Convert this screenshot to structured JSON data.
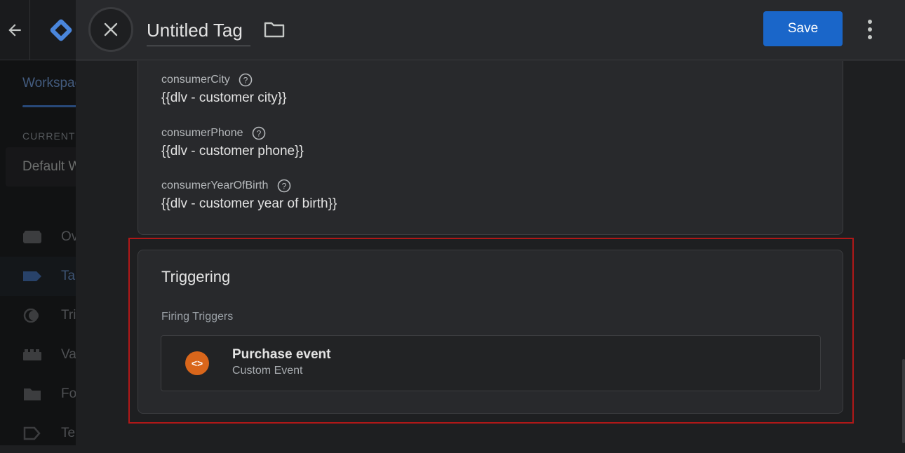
{
  "background": {
    "workspace_tab": "Workspace",
    "current_workspace_label": "CURRENT",
    "workspace_name": "Default W",
    "nav": [
      {
        "label": "Ov",
        "icon": "overview-icon"
      },
      {
        "label": "Ta",
        "icon": "tag-icon"
      },
      {
        "label": "Tri",
        "icon": "trigger-icon"
      },
      {
        "label": "Va",
        "icon": "variables-icon"
      },
      {
        "label": "Fo",
        "icon": "folder-icon"
      },
      {
        "label": "Te",
        "icon": "template-icon"
      }
    ]
  },
  "header": {
    "title": "Untitled Tag",
    "save_label": "Save",
    "close_icon": "close-icon",
    "folder_icon": "folder-icon",
    "more_icon": "more-vert-icon"
  },
  "config": {
    "fields": [
      {
        "label": "consumerCity",
        "value": "{{dlv - customer city}}"
      },
      {
        "label": "consumerPhone",
        "value": "{{dlv - customer phone}}"
      },
      {
        "label": "consumerYearOfBirth",
        "value": "{{dlv - customer year of birth}}"
      }
    ]
  },
  "triggering": {
    "title": "Triggering",
    "firing_label": "Firing Triggers",
    "trigger": {
      "name": "Purchase event",
      "type": "Custom Event",
      "icon": "code-brackets-icon",
      "icon_symbol": "<>",
      "icon_color": "#d9661b"
    }
  },
  "colors": {
    "accent": "#1a66c9",
    "highlight": "#b01818"
  }
}
